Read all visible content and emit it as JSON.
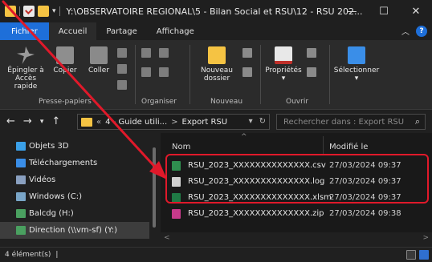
{
  "window": {
    "title": "Y:\\OBSERVATOIRE REGIONAL\\5 - Bilan Social et RSU\\12 - RSU 202...",
    "minimize": "—",
    "maximize": "☐",
    "close": "✕"
  },
  "tabs": {
    "file": "Fichier",
    "home": "Accueil",
    "share": "Partage",
    "view": "Affichage"
  },
  "ribbon": {
    "pin_line1": "Épingler à",
    "pin_line2": "Accès rapide",
    "copy": "Copier",
    "paste": "Coller",
    "new_folder_line1": "Nouveau",
    "new_folder_line2": "dossier",
    "properties": "Propriétés",
    "select": "Sélectionner",
    "group_clipboard": "Presse-papiers",
    "group_organize": "Organiser",
    "group_new": "Nouveau",
    "group_open": "Ouvrir"
  },
  "address": {
    "prefix": "«",
    "crumb1": "4 - Guide utili...",
    "sep": ">",
    "crumb2": "Export RSU",
    "search_placeholder": "Rechercher dans : Export RSU"
  },
  "nav_pane": {
    "items": [
      {
        "label": "Objets 3D",
        "icon": "cube-icon",
        "color": "#3aa0e8"
      },
      {
        "label": "Téléchargements",
        "icon": "download-icon",
        "color": "#3a8ee8"
      },
      {
        "label": "Vidéos",
        "icon": "video-icon",
        "color": "#8aa0c0"
      },
      {
        "label": "Windows (C:)",
        "icon": "drive-icon",
        "color": "#7aa6c8"
      },
      {
        "label": "Balcdg (H:)",
        "icon": "network-drive-icon",
        "color": "#4aa060"
      },
      {
        "label": "Direction (\\\\vm-sf) (Y:)",
        "icon": "network-drive-icon",
        "color": "#4aa060"
      }
    ]
  },
  "columns": {
    "name": "Nom",
    "modified": "Modifié le"
  },
  "files": [
    {
      "name": "RSU_2023_XXXXXXXXXXXXXX.csv",
      "date": "27/03/2024 09:37",
      "icon": "csv-file-icon",
      "color": "#2f8f4f"
    },
    {
      "name": "RSU_2023_XXXXXXXXXXXXXX.log",
      "date": "27/03/2024 09:37",
      "icon": "text-file-icon",
      "color": "#d0d0d0"
    },
    {
      "name": "RSU_2023_XXXXXXXXXXXXXX.xlsm",
      "date": "27/03/2024 09:37",
      "icon": "excel-file-icon",
      "color": "#1f7a45"
    },
    {
      "name": "RSU_2023_XXXXXXXXXXXXXX.zip",
      "date": "27/03/2024 09:38",
      "icon": "zip-file-icon",
      "color": "#c63a8a"
    }
  ],
  "status": {
    "count": "4 élément(s)",
    "sep": "|"
  },
  "colors": {
    "accent": "#1e6fd9",
    "annotation": "#e0192a"
  }
}
